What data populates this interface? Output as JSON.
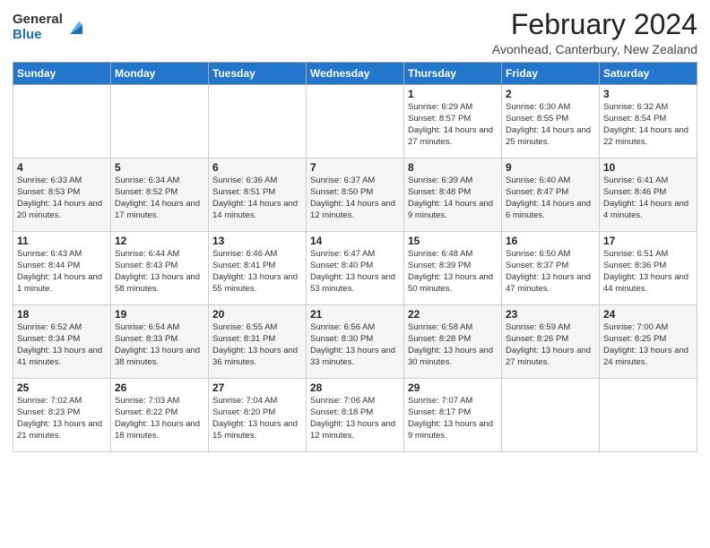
{
  "header": {
    "logo_general": "General",
    "logo_blue": "Blue",
    "month_year": "February 2024",
    "location": "Avonhead, Canterbury, New Zealand"
  },
  "weekdays": [
    "Sunday",
    "Monday",
    "Tuesday",
    "Wednesday",
    "Thursday",
    "Friday",
    "Saturday"
  ],
  "weeks": [
    [
      {
        "day": "",
        "detail": ""
      },
      {
        "day": "",
        "detail": ""
      },
      {
        "day": "",
        "detail": ""
      },
      {
        "day": "",
        "detail": ""
      },
      {
        "day": "1",
        "detail": "Sunrise: 6:29 AM\nSunset: 8:57 PM\nDaylight: 14 hours and 27 minutes."
      },
      {
        "day": "2",
        "detail": "Sunrise: 6:30 AM\nSunset: 8:55 PM\nDaylight: 14 hours and 25 minutes."
      },
      {
        "day": "3",
        "detail": "Sunrise: 6:32 AM\nSunset: 8:54 PM\nDaylight: 14 hours and 22 minutes."
      }
    ],
    [
      {
        "day": "4",
        "detail": "Sunrise: 6:33 AM\nSunset: 8:53 PM\nDaylight: 14 hours and 20 minutes."
      },
      {
        "day": "5",
        "detail": "Sunrise: 6:34 AM\nSunset: 8:52 PM\nDaylight: 14 hours and 17 minutes."
      },
      {
        "day": "6",
        "detail": "Sunrise: 6:36 AM\nSunset: 8:51 PM\nDaylight: 14 hours and 14 minutes."
      },
      {
        "day": "7",
        "detail": "Sunrise: 6:37 AM\nSunset: 8:50 PM\nDaylight: 14 hours and 12 minutes."
      },
      {
        "day": "8",
        "detail": "Sunrise: 6:39 AM\nSunset: 8:48 PM\nDaylight: 14 hours and 9 minutes."
      },
      {
        "day": "9",
        "detail": "Sunrise: 6:40 AM\nSunset: 8:47 PM\nDaylight: 14 hours and 6 minutes."
      },
      {
        "day": "10",
        "detail": "Sunrise: 6:41 AM\nSunset: 8:46 PM\nDaylight: 14 hours and 4 minutes."
      }
    ],
    [
      {
        "day": "11",
        "detail": "Sunrise: 6:43 AM\nSunset: 8:44 PM\nDaylight: 14 hours and 1 minute."
      },
      {
        "day": "12",
        "detail": "Sunrise: 6:44 AM\nSunset: 8:43 PM\nDaylight: 13 hours and 58 minutes."
      },
      {
        "day": "13",
        "detail": "Sunrise: 6:46 AM\nSunset: 8:41 PM\nDaylight: 13 hours and 55 minutes."
      },
      {
        "day": "14",
        "detail": "Sunrise: 6:47 AM\nSunset: 8:40 PM\nDaylight: 13 hours and 53 minutes."
      },
      {
        "day": "15",
        "detail": "Sunrise: 6:48 AM\nSunset: 8:39 PM\nDaylight: 13 hours and 50 minutes."
      },
      {
        "day": "16",
        "detail": "Sunrise: 6:50 AM\nSunset: 8:37 PM\nDaylight: 13 hours and 47 minutes."
      },
      {
        "day": "17",
        "detail": "Sunrise: 6:51 AM\nSunset: 8:36 PM\nDaylight: 13 hours and 44 minutes."
      }
    ],
    [
      {
        "day": "18",
        "detail": "Sunrise: 6:52 AM\nSunset: 8:34 PM\nDaylight: 13 hours and 41 minutes."
      },
      {
        "day": "19",
        "detail": "Sunrise: 6:54 AM\nSunset: 8:33 PM\nDaylight: 13 hours and 38 minutes."
      },
      {
        "day": "20",
        "detail": "Sunrise: 6:55 AM\nSunset: 8:31 PM\nDaylight: 13 hours and 36 minutes."
      },
      {
        "day": "21",
        "detail": "Sunrise: 6:56 AM\nSunset: 8:30 PM\nDaylight: 13 hours and 33 minutes."
      },
      {
        "day": "22",
        "detail": "Sunrise: 6:58 AM\nSunset: 8:28 PM\nDaylight: 13 hours and 30 minutes."
      },
      {
        "day": "23",
        "detail": "Sunrise: 6:59 AM\nSunset: 8:26 PM\nDaylight: 13 hours and 27 minutes."
      },
      {
        "day": "24",
        "detail": "Sunrise: 7:00 AM\nSunset: 8:25 PM\nDaylight: 13 hours and 24 minutes."
      }
    ],
    [
      {
        "day": "25",
        "detail": "Sunrise: 7:02 AM\nSunset: 8:23 PM\nDaylight: 13 hours and 21 minutes."
      },
      {
        "day": "26",
        "detail": "Sunrise: 7:03 AM\nSunset: 8:22 PM\nDaylight: 13 hours and 18 minutes."
      },
      {
        "day": "27",
        "detail": "Sunrise: 7:04 AM\nSunset: 8:20 PM\nDaylight: 13 hours and 15 minutes."
      },
      {
        "day": "28",
        "detail": "Sunrise: 7:06 AM\nSunset: 8:18 PM\nDaylight: 13 hours and 12 minutes."
      },
      {
        "day": "29",
        "detail": "Sunrise: 7:07 AM\nSunset: 8:17 PM\nDaylight: 13 hours and 9 minutes."
      },
      {
        "day": "",
        "detail": ""
      },
      {
        "day": "",
        "detail": ""
      }
    ]
  ]
}
